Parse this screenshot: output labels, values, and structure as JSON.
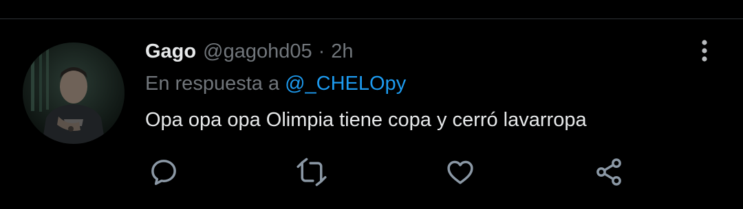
{
  "tweet": {
    "display_name": "Gago",
    "handle": "@gagohd05",
    "separator": "·",
    "time": "2h",
    "reply_prefix": "En respuesta a",
    "reply_to": "@_CHELOpy",
    "text": "Opa opa opa Olimpia tiene copa y cerró lavarropa"
  },
  "colors": {
    "background": "#000000",
    "primary_text": "#e7e9ea",
    "secondary_text": "#71767b",
    "link": "#1d9bf0",
    "divider": "#2f3336"
  },
  "icons": {
    "more": "more-vertical-icon",
    "reply": "reply-icon",
    "retweet": "retweet-icon",
    "like": "heart-icon",
    "share": "share-icon"
  }
}
